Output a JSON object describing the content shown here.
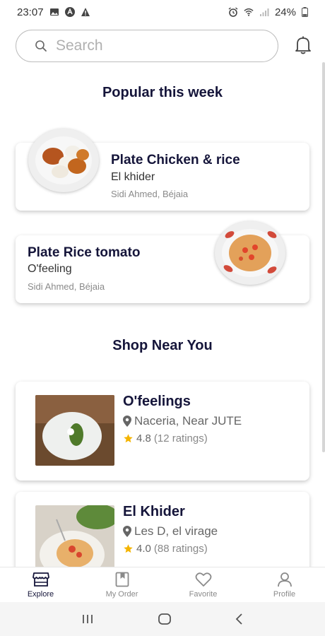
{
  "status_bar": {
    "time": "23:07",
    "battery": "24%"
  },
  "search": {
    "placeholder": "Search"
  },
  "popular": {
    "title": "Popular this week",
    "items": [
      {
        "title": "Plate Chicken & rice",
        "shop": "El khider",
        "location": "Sidi Ahmed, Béjaia"
      },
      {
        "title": "Plate Rice tomato",
        "shop": "O'feeling",
        "location": "Sidi Ahmed, Béjaia"
      }
    ]
  },
  "shops": {
    "title": "Shop Near You",
    "items": [
      {
        "name": "O'feelings",
        "address": "Naceria, Near JUTE",
        "rating": "4.8",
        "ratings_count": "(12 ratings)"
      },
      {
        "name": "El Khider",
        "address": "Les D, el virage",
        "rating": "4.0",
        "ratings_count": "(88 ratings)"
      }
    ]
  },
  "bottom_nav": {
    "items": [
      {
        "label": "Explore",
        "icon": "store-icon",
        "active": true
      },
      {
        "label": "My Order",
        "icon": "bookmark-book-icon",
        "active": false
      },
      {
        "label": "Favorite",
        "icon": "heart-icon",
        "active": false
      },
      {
        "label": "Profile",
        "icon": "user-icon",
        "active": false
      }
    ]
  },
  "colors": {
    "heading": "#15153a",
    "star": "#f4b400",
    "muted": "#8a8a8a"
  }
}
